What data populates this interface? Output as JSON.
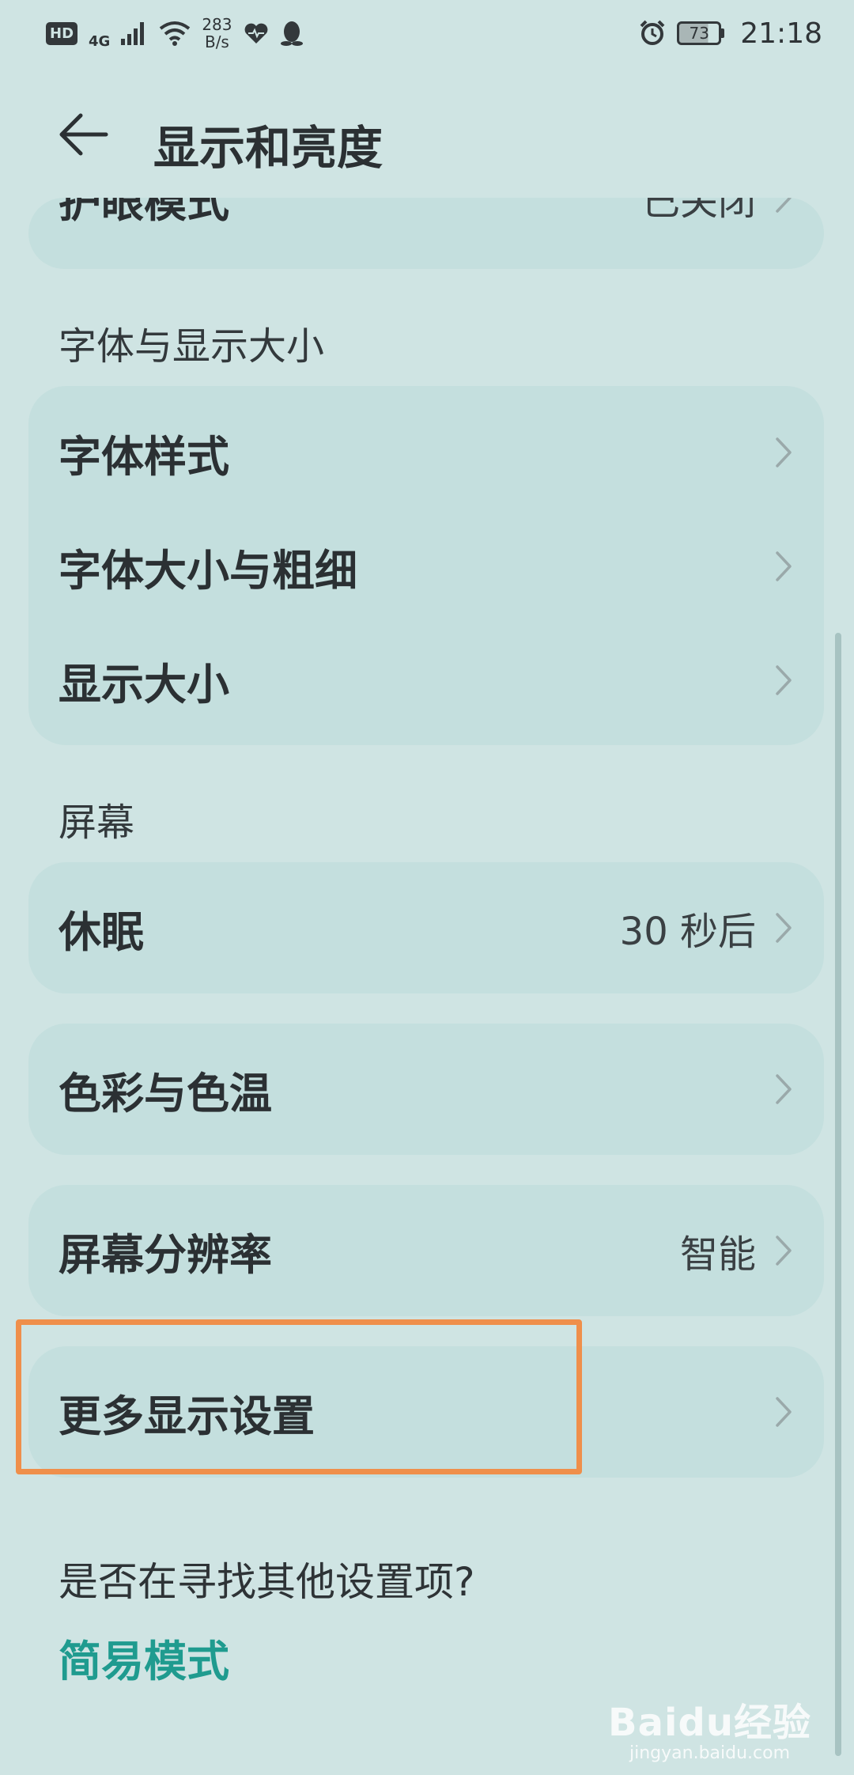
{
  "status_bar": {
    "hd": "HD",
    "network": "4G",
    "speed_value": "283",
    "speed_unit": "B/s",
    "battery": "73",
    "time": "21:18"
  },
  "header": {
    "title": "显示和亮度"
  },
  "cards": {
    "eye_comfort": {
      "label": "护眼模式",
      "value": "已关闭"
    },
    "font_section": "字体与显示大小",
    "font_style": "字体样式",
    "font_size": "字体大小与粗细",
    "display_size": "显示大小",
    "screen_section": "屏幕",
    "sleep": {
      "label": "休眠",
      "value": "30 秒后"
    },
    "color": "色彩与色温",
    "resolution": {
      "label": "屏幕分辨率",
      "value": "智能"
    },
    "more": "更多显示设置"
  },
  "footer": {
    "question": "是否在寻找其他设置项?",
    "link": "简易模式"
  },
  "watermark": {
    "logo": "Baidu经验",
    "sub": "jingyan.baidu.com"
  }
}
